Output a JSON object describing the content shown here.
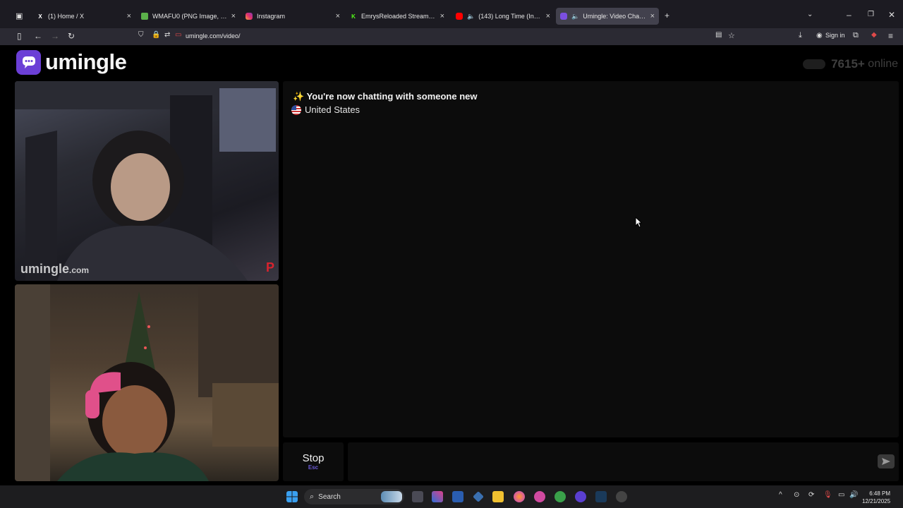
{
  "browser": {
    "tabs": [
      {
        "label": "(1) Home / X",
        "favicon": "x-icon",
        "color": "#ffffff"
      },
      {
        "label": "WMAFU0 (PNG Image, 873 × 1",
        "favicon": "image-icon",
        "color": "#5bb04a"
      },
      {
        "label": "Instagram",
        "favicon": "instagram-icon",
        "color": "#e1306c"
      },
      {
        "label": "EmrysReloaded Stream - Watch",
        "favicon": "kick-icon",
        "color": "#53fc18"
      },
      {
        "label": "(143) Long Time (Intro) - Yo",
        "favicon": "youtube-icon",
        "color": "#ff0000"
      },
      {
        "label": "Umingle: Video Chat with S",
        "favicon": "umingle-icon",
        "color": "#7b4fe0"
      }
    ],
    "url": "umingle.com/video/",
    "sign_in_label": "Sign in"
  },
  "page": {
    "brand": "umingle",
    "online_count": "7615+",
    "online_label": "online",
    "watermark_main": "umingle",
    "watermark_suffix": ".com",
    "watermark_mark": "P",
    "chat": {
      "status_message": "✨ You're now chatting with someone new",
      "country": "United States"
    },
    "stop_button": {
      "label": "Stop",
      "shortcut": "Esc"
    },
    "message_input": {
      "value": "",
      "placeholder": ""
    }
  },
  "taskbar": {
    "search_label": "Search",
    "time": "6:48 PM",
    "date": "12/21/2025"
  },
  "colors": {
    "accent": "#6b3fd6",
    "chat_bg": "#0c0c0c",
    "page_bg": "#000000"
  }
}
